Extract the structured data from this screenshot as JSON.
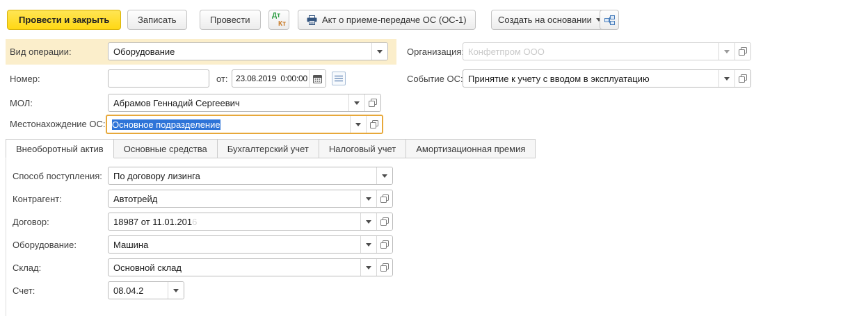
{
  "toolbar": {
    "commit_close_label": "Провести и закрыть",
    "save_label": "Записать",
    "post_label": "Провести",
    "dt_label": "Дт",
    "kt_label": "Кт",
    "print_act_label": "Акт о приеме-передаче ОС (ОС-1)",
    "create_based_on_label": "Создать на основании"
  },
  "header": {
    "operation_label": "Вид операции:",
    "operation_value": "Оборудование",
    "organization_label": "Организация:",
    "organization_value": "Конфетпром ООО",
    "number_label": "Номер:",
    "number_value": "",
    "date_prefix_label": "от:",
    "date_value": "23.08.2019  0:00:00",
    "event_label": "Событие ОС:",
    "event_value": "Принятие к учету с вводом в эксплуатацию",
    "mol_label": "МОЛ:",
    "mol_value": "Абрамов Геннадий Сергеевич",
    "location_label": "Местонахождение ОС:",
    "location_value": "Основное подразделение"
  },
  "tabs": [
    "Внеоборотный актив",
    "Основные средства",
    "Бухгалтерский учет",
    "Налоговый учет",
    "Амортизационная премия"
  ],
  "asset_tab": {
    "method_label": "Способ поступления:",
    "method_value": "По договору лизинга",
    "counterparty_label": "Контрагент:",
    "counterparty_value": "Автотрейд",
    "contract_label": "Договор:",
    "contract_value": "18987 от 11.01.201",
    "contract_value_faded": "6",
    "equipment_label": "Оборудование:",
    "equipment_value": "Машина",
    "warehouse_label": "Склад:",
    "warehouse_value": "Основной склад",
    "account_label": "Счет:",
    "account_value": "08.04.2"
  },
  "colors": {
    "primary_button_bg": "#ffd814",
    "required_row_bg": "#fbeecb",
    "focus_border": "#e7a83a",
    "selection_bg": "#2e74d8",
    "disabled_text": "#c9c9c9"
  },
  "icons": {
    "printer": "printer-icon",
    "calendar": "calendar-icon",
    "list": "list-icon",
    "dropdown": "chevron-down-icon",
    "open": "open-icon",
    "related_documents": "related-documents-icon",
    "dt_kt": "dt-kt-icon"
  }
}
